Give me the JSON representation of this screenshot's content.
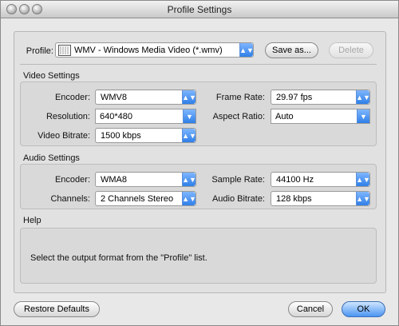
{
  "window": {
    "title": "Profile Settings"
  },
  "profile": {
    "label": "Profile:",
    "value": "WMV - Windows Media Video (*.wmv)",
    "save_as_label": "Save as...",
    "delete_label": "Delete"
  },
  "video": {
    "section_label": "Video Settings",
    "encoder": {
      "label": "Encoder:",
      "value": "WMV8"
    },
    "frame_rate": {
      "label": "Frame Rate:",
      "value": "29.97 fps"
    },
    "resolution": {
      "label": "Resolution:",
      "value": "640*480"
    },
    "aspect_ratio": {
      "label": "Aspect Ratio:",
      "value": "Auto"
    },
    "video_bitrate": {
      "label": "Video Bitrate:",
      "value": "1500 kbps"
    }
  },
  "audio": {
    "section_label": "Audio Settings",
    "encoder": {
      "label": "Encoder:",
      "value": "WMA8"
    },
    "sample_rate": {
      "label": "Sample Rate:",
      "value": "44100 Hz"
    },
    "channels": {
      "label": "Channels:",
      "value": "2 Channels Stereo"
    },
    "audio_bitrate": {
      "label": "Audio Bitrate:",
      "value": "128 kbps"
    }
  },
  "help": {
    "section_label": "Help",
    "text": "Select the output format from the \"Profile\" list."
  },
  "footer": {
    "restore_label": "Restore Defaults",
    "cancel_label": "Cancel",
    "ok_label": "OK"
  }
}
